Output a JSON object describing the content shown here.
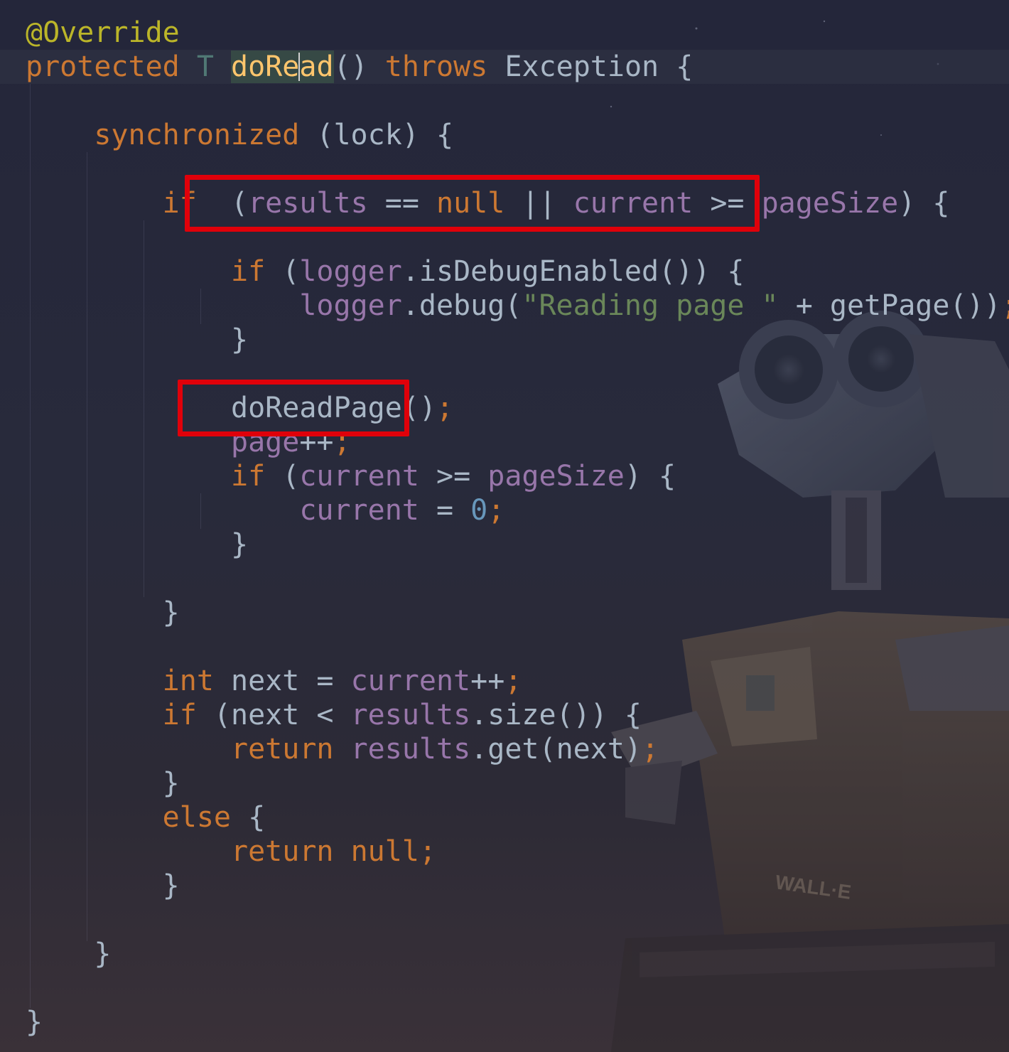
{
  "editor": {
    "language": "java",
    "background_accent": "#262637",
    "highlight_color": "#e0000a"
  },
  "code": {
    "l01": {
      "ann": "@Override"
    },
    "l02": {
      "kw1": "protected",
      "type": "T",
      "name_a": "doRe",
      "name_b": "ad",
      "paren": "()",
      "kw2": "throws",
      "exc": "Exception {"
    },
    "l04": {
      "kw": "synchronized",
      "rest": " (lock) {"
    },
    "l06": {
      "kw": "if",
      "open": "(",
      "f1": "results",
      "op1": " == ",
      "nul": "null",
      "op2": " || ",
      "f2": "current",
      "op3": " >= ",
      "f3": "pageSize",
      "close": ")",
      "brace": " {"
    },
    "l08": {
      "kw": "if",
      "open": " (",
      "f1": "logger",
      "rest": ".isDebugEnabled()) {"
    },
    "l09": {
      "f1": "logger",
      "call": ".debug(",
      "str": "\"Reading page \"",
      "rest": " + getPage())",
      "semi": ";"
    },
    "l10": {
      "brace": "}"
    },
    "l12": {
      "call": "doReadPage()",
      "semi": ";"
    },
    "l13": {
      "f1": "page",
      "op": "++",
      "semi": ";"
    },
    "l14": {
      "kw": "if",
      "open": " (",
      "f1": "current",
      "op": " >= ",
      "f2": "pageSize",
      "rest": ") {"
    },
    "l15": {
      "f1": "current",
      "op": " = ",
      "num": "0",
      "semi": ";"
    },
    "l16": {
      "brace": "}"
    },
    "l18": {
      "brace": "}"
    },
    "l20": {
      "kw": "int",
      "rest": " next = ",
      "f1": "current",
      "op": "++",
      "semi": ";"
    },
    "l21": {
      "kw": "if",
      "rest": " (next < ",
      "f1": "results",
      "rest2": ".size()) {"
    },
    "l22": {
      "kw": "return",
      "sp": " ",
      "f1": "results",
      "rest": ".get(next)",
      "semi": ";"
    },
    "l23": {
      "brace": "}"
    },
    "l24": {
      "kw": "else",
      "rest": " {"
    },
    "l25": {
      "kw": "return",
      "sp": " ",
      "nul": "null",
      "semi": ";"
    },
    "l26": {
      "brace": "}"
    },
    "l28": {
      "brace": "}"
    },
    "l30": {
      "brace": "}"
    }
  }
}
